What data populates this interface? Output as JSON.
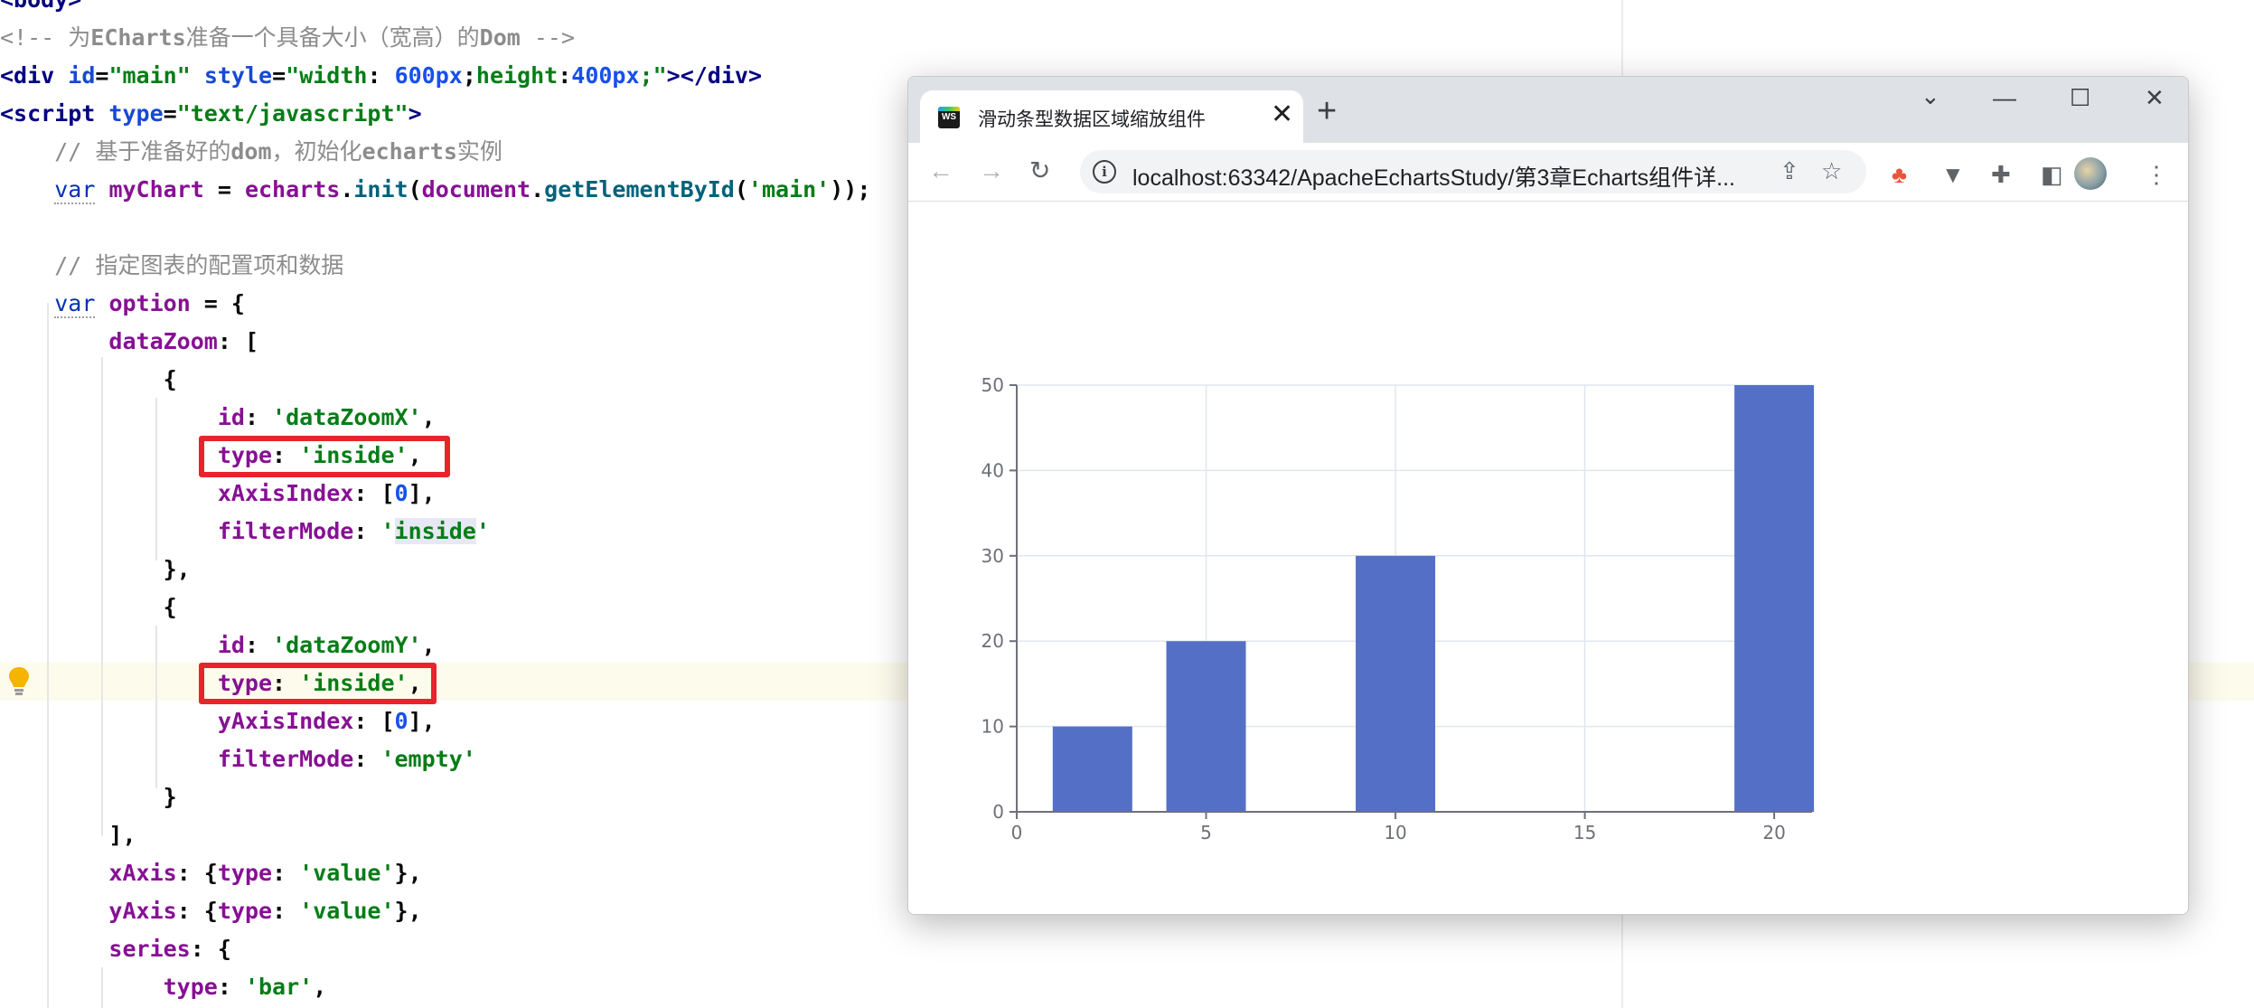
{
  "editor": {
    "lines": [
      [
        {
          "t": "<body>",
          "c": "tag"
        }
      ],
      [
        {
          "t": "<!-- 为",
          "c": "com"
        },
        {
          "t": "ECharts",
          "c": "comb"
        },
        {
          "t": "准备一个具备大小（宽高）的",
          "c": "com"
        },
        {
          "t": "Dom",
          "c": "comb"
        },
        {
          "t": " -->",
          "c": "com"
        }
      ],
      [
        {
          "t": "<div ",
          "c": "tag"
        },
        {
          "t": "id",
          "c": "attr"
        },
        {
          "t": "=",
          "c": "pun"
        },
        {
          "t": "\"main\"",
          "c": "str"
        },
        {
          "t": " ",
          "c": "pun"
        },
        {
          "t": "style",
          "c": "attr"
        },
        {
          "t": "=",
          "c": "pun"
        },
        {
          "t": "\"width",
          "c": "str"
        },
        {
          "t": ": ",
          "c": "pun"
        },
        {
          "t": "600px",
          "c": "num"
        },
        {
          "t": ";",
          "c": "pun"
        },
        {
          "t": "height",
          "c": "str"
        },
        {
          "t": ":",
          "c": "pun"
        },
        {
          "t": "400px",
          "c": "num"
        },
        {
          "t": ";\"",
          "c": "str"
        },
        {
          "t": "></div>",
          "c": "tag"
        }
      ],
      [
        {
          "t": "<script ",
          "c": "tag"
        },
        {
          "t": "type",
          "c": "attr"
        },
        {
          "t": "=",
          "c": "pun"
        },
        {
          "t": "\"text/javascript\"",
          "c": "str"
        },
        {
          "t": ">",
          "c": "tag"
        }
      ],
      [
        {
          "t": "    // 基于准备好的",
          "c": "com"
        },
        {
          "t": "dom",
          "c": "comb"
        },
        {
          "t": "，初始化",
          "c": "com"
        },
        {
          "t": "echarts",
          "c": "comb"
        },
        {
          "t": "实例",
          "c": "com"
        }
      ],
      [
        {
          "t": "    ",
          "c": "pun"
        },
        {
          "t": "var",
          "c": "kw",
          "u": 1
        },
        {
          "t": " ",
          "c": "pun"
        },
        {
          "t": "myChart",
          "c": "var"
        },
        {
          "t": " = ",
          "c": "pun"
        },
        {
          "t": "echarts",
          "c": "var"
        },
        {
          "t": ".",
          "c": "pun"
        },
        {
          "t": "init",
          "c": "fn"
        },
        {
          "t": "(",
          "c": "pun"
        },
        {
          "t": "document",
          "c": "var"
        },
        {
          "t": ".",
          "c": "pun"
        },
        {
          "t": "getElementById",
          "c": "fn"
        },
        {
          "t": "(",
          "c": "pun"
        },
        {
          "t": "'main'",
          "c": "str"
        },
        {
          "t": "));",
          "c": "pun"
        }
      ],
      [],
      [
        {
          "t": "    // 指定图表的配置项和数据",
          "c": "com"
        }
      ],
      [
        {
          "t": "    ",
          "c": "pun"
        },
        {
          "t": "var",
          "c": "kw",
          "u": 1
        },
        {
          "t": " ",
          "c": "pun"
        },
        {
          "t": "option",
          "c": "var"
        },
        {
          "t": " = {",
          "c": "pun"
        }
      ],
      [
        {
          "t": "        ",
          "c": "pun"
        },
        {
          "t": "dataZoom",
          "c": "prop"
        },
        {
          "t": ": [",
          "c": "pun"
        }
      ],
      [
        {
          "t": "            {",
          "c": "pun"
        }
      ],
      [
        {
          "t": "                ",
          "c": "pun"
        },
        {
          "t": "id",
          "c": "prop"
        },
        {
          "t": ": ",
          "c": "pun"
        },
        {
          "t": "'dataZoomX'",
          "c": "str"
        },
        {
          "t": ",",
          "c": "pun"
        }
      ],
      [
        {
          "t": "                ",
          "c": "pun"
        },
        {
          "t": "type",
          "c": "prop"
        },
        {
          "t": ": ",
          "c": "pun"
        },
        {
          "t": "'inside'",
          "c": "str"
        },
        {
          "t": ",",
          "c": "pun"
        }
      ],
      [
        {
          "t": "                ",
          "c": "pun"
        },
        {
          "t": "xAxisIndex",
          "c": "prop"
        },
        {
          "t": ": [",
          "c": "pun"
        },
        {
          "t": "0",
          "c": "num"
        },
        {
          "t": "],",
          "c": "pun"
        }
      ],
      [
        {
          "t": "                ",
          "c": "pun"
        },
        {
          "t": "filterMode",
          "c": "prop"
        },
        {
          "t": ": ",
          "c": "pun"
        },
        {
          "t": "'",
          "c": "str"
        },
        {
          "t": "inside",
          "c": "str",
          "s": 1
        },
        {
          "t": "'",
          "c": "str"
        }
      ],
      [
        {
          "t": "            },",
          "c": "pun"
        }
      ],
      [
        {
          "t": "            {",
          "c": "pun"
        }
      ],
      [
        {
          "t": "                ",
          "c": "pun"
        },
        {
          "t": "id",
          "c": "prop"
        },
        {
          "t": ": ",
          "c": "pun"
        },
        {
          "t": "'dataZoomY'",
          "c": "str"
        },
        {
          "t": ",",
          "c": "pun"
        }
      ],
      [
        {
          "t": "                ",
          "c": "pun"
        },
        {
          "t": "type",
          "c": "prop"
        },
        {
          "t": ": ",
          "c": "pun"
        },
        {
          "t": "'inside'",
          "c": "str"
        },
        {
          "t": ",",
          "c": "pun"
        }
      ],
      [
        {
          "t": "                ",
          "c": "pun"
        },
        {
          "t": "yAxisIndex",
          "c": "prop"
        },
        {
          "t": ": [",
          "c": "pun"
        },
        {
          "t": "0",
          "c": "num"
        },
        {
          "t": "],",
          "c": "pun"
        }
      ],
      [
        {
          "t": "                ",
          "c": "pun"
        },
        {
          "t": "filterMode",
          "c": "prop"
        },
        {
          "t": ": ",
          "c": "pun"
        },
        {
          "t": "'empty'",
          "c": "str"
        }
      ],
      [
        {
          "t": "            }",
          "c": "pun"
        }
      ],
      [
        {
          "t": "        ],",
          "c": "pun"
        }
      ],
      [
        {
          "t": "        ",
          "c": "pun"
        },
        {
          "t": "xAxis",
          "c": "prop"
        },
        {
          "t": ": {",
          "c": "pun"
        },
        {
          "t": "type",
          "c": "prop"
        },
        {
          "t": ": ",
          "c": "pun"
        },
        {
          "t": "'value'",
          "c": "str"
        },
        {
          "t": "},",
          "c": "pun"
        }
      ],
      [
        {
          "t": "        ",
          "c": "pun"
        },
        {
          "t": "yAxis",
          "c": "prop"
        },
        {
          "t": ": {",
          "c": "pun"
        },
        {
          "t": "type",
          "c": "prop"
        },
        {
          "t": ": ",
          "c": "pun"
        },
        {
          "t": "'value'",
          "c": "str"
        },
        {
          "t": "},",
          "c": "pun"
        }
      ],
      [
        {
          "t": "        ",
          "c": "pun"
        },
        {
          "t": "series",
          "c": "prop"
        },
        {
          "t": ": {",
          "c": "pun"
        }
      ],
      [
        {
          "t": "            ",
          "c": "pun"
        },
        {
          "t": "type",
          "c": "prop"
        },
        {
          "t": ": ",
          "c": "pun"
        },
        {
          "t": "'bar'",
          "c": "str"
        },
        {
          "t": ",",
          "c": "pun"
        }
      ]
    ],
    "highlight_color": "#e8232c",
    "bulb_icon": "lightbulb-icon"
  },
  "browser": {
    "tab_title": "滑动条型数据区域缩放组件",
    "tab_icon_text": "WS",
    "tab_close": "✕",
    "new_tab": "+",
    "url": "localhost:63342/ApacheEchartsStudy/第3章Echarts组件详...",
    "controls": {
      "chevron": "⌄",
      "minimize": "—",
      "maximize": "☐",
      "close": "✕"
    },
    "nav": {
      "back": "←",
      "forward": "→",
      "reload": "↻"
    },
    "omnibox_icons": {
      "share": "⇪",
      "star": "☆"
    },
    "toolbar_icons": {
      "ext1": "♣",
      "ext2": "▼",
      "puzzle": "✚",
      "sidebar": "◧",
      "menu": "⋮"
    }
  },
  "chart_data": {
    "type": "bar",
    "x_axis": {
      "type": "value",
      "min": 0,
      "max": 21,
      "ticks": [
        0,
        5,
        10,
        15,
        20
      ]
    },
    "y_axis": {
      "type": "value",
      "min": 0,
      "max": 50,
      "ticks": [
        0,
        10,
        20,
        30,
        40,
        50
      ]
    },
    "series": [
      {
        "values": [
          [
            2,
            10
          ],
          [
            5,
            20
          ],
          [
            10,
            30
          ],
          [
            20,
            50
          ]
        ]
      }
    ],
    "bar_color": "#5470c6",
    "grid": true
  }
}
